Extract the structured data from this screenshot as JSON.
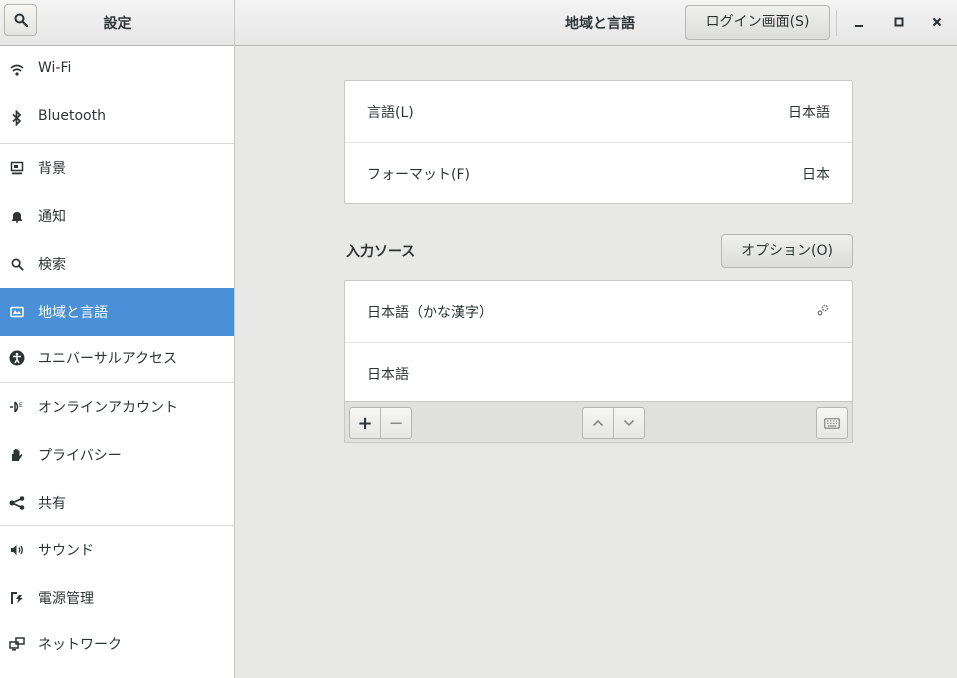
{
  "header": {
    "app_title": "設定",
    "page_title": "地域と言語",
    "login_button": "ログイン画面(S)"
  },
  "sidebar": {
    "items": [
      {
        "label": "Wi-Fi",
        "icon": "wifi-icon"
      },
      {
        "label": "Bluetooth",
        "icon": "bluetooth-icon"
      },
      {
        "label": "背景",
        "icon": "background-icon"
      },
      {
        "label": "通知",
        "icon": "bell-icon"
      },
      {
        "label": "検索",
        "icon": "search-icon"
      },
      {
        "label": "地域と言語",
        "icon": "region-icon",
        "selected": true
      },
      {
        "label": "ユニバーサルアクセス",
        "icon": "accessibility-icon"
      },
      {
        "label": "オンラインアカウント",
        "icon": "online-accounts-icon"
      },
      {
        "label": "プライバシー",
        "icon": "hand-icon"
      },
      {
        "label": "共有",
        "icon": "share-icon"
      },
      {
        "label": "サウンド",
        "icon": "speaker-icon"
      },
      {
        "label": "電源管理",
        "icon": "power-icon"
      },
      {
        "label": "ネットワーク",
        "icon": "network-icon"
      }
    ]
  },
  "language_panel": {
    "rows": [
      {
        "label": "言語(L)",
        "value": "日本語"
      },
      {
        "label": "フォーマット(F)",
        "value": "日本"
      }
    ]
  },
  "input_sources": {
    "title": "入力ソース",
    "options_button": "オプション(O)",
    "items": [
      {
        "label": "日本語（かな漢字）",
        "has_settings": true
      },
      {
        "label": "日本語",
        "has_settings": false
      }
    ],
    "toolbar": {
      "add": "+",
      "remove": "−"
    }
  },
  "colors": {
    "accent": "#4a90d9",
    "background": "#e8e8e7"
  }
}
